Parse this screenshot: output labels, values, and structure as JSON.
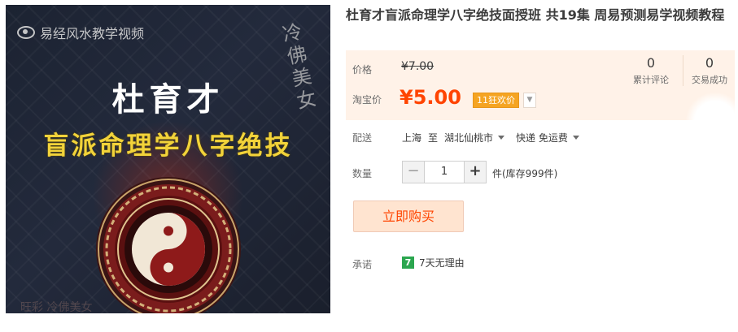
{
  "image": {
    "channel": "易经风水教学视频",
    "seal": "冷佛美女",
    "author": "杜育才",
    "subtitle": "盲派命理学八字绝技",
    "footer_mark": "旺彩 冷佛美女"
  },
  "product": {
    "title": "杜育才盲派命理学八字绝技面授班 共19集 周易预测易学视频教程"
  },
  "price": {
    "orig_label": "价格",
    "orig_value": "¥7.00",
    "promo_label": "淘宝价",
    "promo_value": "¥5.00",
    "promo_badge": "11狂欢价"
  },
  "stats": {
    "reviews_count": "0",
    "reviews_label": "累计评论",
    "trades_count": "0",
    "trades_label": "交易成功"
  },
  "shipping": {
    "label": "配送",
    "from": "上海",
    "to_word": "至",
    "destination": "湖北仙桃市",
    "method": "快递 免运费"
  },
  "quantity": {
    "label": "数量",
    "minus": "−",
    "value": "1",
    "plus": "+",
    "stock": "件(库存999件)"
  },
  "buy": {
    "label": "立即购买"
  },
  "promise": {
    "label": "承诺",
    "icon_text": "7",
    "text": "7天无理由"
  },
  "colors": {
    "price_orange": "#ff4400",
    "badge_orange": "#f5a422",
    "panel_bg": "#fff2e8",
    "promise_green": "#2ba64f"
  }
}
